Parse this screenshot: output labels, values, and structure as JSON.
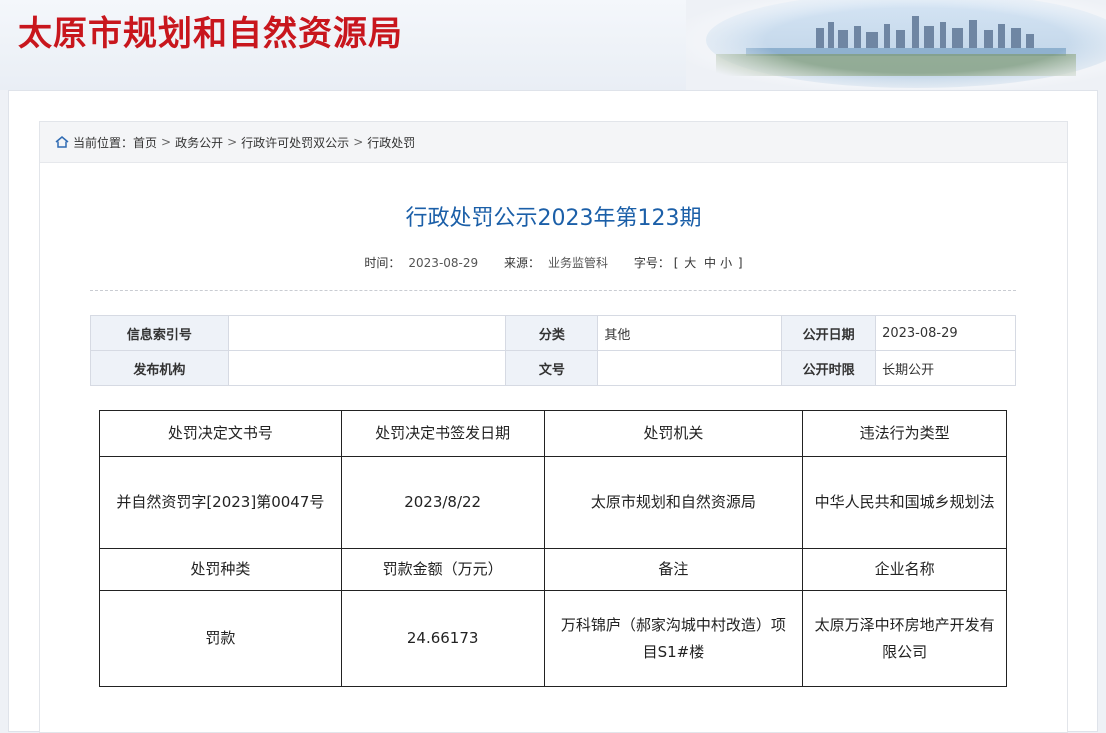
{
  "header": {
    "site_title": "太原市规划和自然资源局"
  },
  "breadcrumb": {
    "prefix": "当前位置：",
    "items": [
      "首页",
      "政务公开",
      "行政许可处罚双公示",
      "行政处罚"
    ],
    "separator": ">"
  },
  "article": {
    "title": "行政处罚公示2023年第123期",
    "time_label": "时间：",
    "time_value": "2023-08-29",
    "source_label": "来源：",
    "source_value": "业务监管科",
    "font_label": "字号：",
    "font_open": "[",
    "font_large": "大",
    "font_medium": "中",
    "font_small": "小",
    "font_close": "]"
  },
  "info_table": {
    "index_label": "信息索引号",
    "index_value": "",
    "category_label": "分类",
    "category_value": "其他",
    "date_label": "公开日期",
    "date_value": "2023-08-29",
    "issuer_label": "发布机构",
    "issuer_value": "",
    "doc_label": "文号",
    "doc_value": "",
    "period_label": "公开时限",
    "period_value": "长期公开"
  },
  "content_table": {
    "headers1": [
      "处罚决定文书号",
      "处罚决定书签发日期",
      "处罚机关",
      "违法行为类型"
    ],
    "row1": [
      "并自然资罚字[2023]第0047号",
      "2023/8/22",
      "太原市规划和自然资源局",
      "中华人民共和国城乡规划法"
    ],
    "headers2": [
      "处罚种类",
      "罚款金额（万元）",
      "备注",
      "企业名称"
    ],
    "row2": [
      "罚款",
      "24.66173",
      "万科锦庐（郝家沟城中村改造）项目S1#楼",
      "太原万泽中环房地产开发有限公司"
    ]
  },
  "colors": {
    "title_red": "#c8161d",
    "title_blue": "#1b5fa8"
  }
}
